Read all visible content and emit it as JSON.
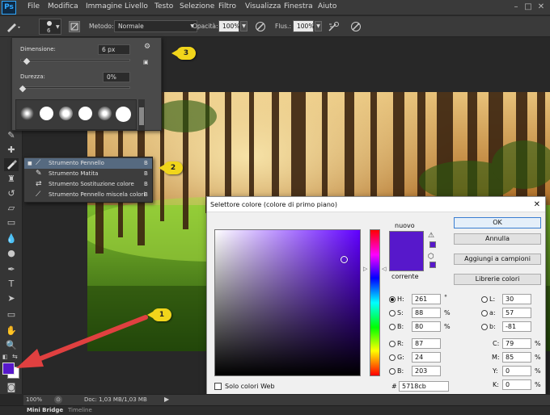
{
  "app": {
    "logo": "Ps",
    "menus": [
      "File",
      "Modifica",
      "Immagine",
      "Livello",
      "Testo",
      "Selezione",
      "Filtro",
      "Visualizza",
      "Finestra",
      "Aiuto"
    ],
    "window_controls": [
      "–",
      "□",
      "✕"
    ]
  },
  "options_bar": {
    "brush_size": "6",
    "metodo_label": "Metodo:",
    "metodo_value": "Normale",
    "opacita_label": "Opacità:",
    "opacita_value": "100%",
    "flusso_label": "Flus.:",
    "flusso_value": "100%"
  },
  "brush_popup": {
    "dimensione_label": "Dimensione:",
    "dimensione_value": "6 px",
    "durezza_label": "Durezza:",
    "durezza_value": "0%",
    "dimensione_level": 0.04,
    "durezza_level": 0.0
  },
  "tool_flyout": {
    "items": [
      {
        "label": "Strumento Pennello",
        "key": "B",
        "selected": true
      },
      {
        "label": "Strumento Matita",
        "key": "B",
        "selected": false
      },
      {
        "label": "Strumento Sostituzione colore",
        "key": "B",
        "selected": false
      },
      {
        "label": "Strumento Pennello miscela colori",
        "key": "B",
        "selected": false
      }
    ]
  },
  "callouts": [
    "1",
    "2",
    "3"
  ],
  "color_picker": {
    "title": "Selettore colore (colore di primo piano)",
    "close": "✕",
    "nuovo_label": "nuovo",
    "corrente_label": "corrente",
    "ok": "OK",
    "annulla": "Annulla",
    "aggiungi": "Aggiungi a campioni",
    "librerie": "Librerie colori",
    "solo_web": "Solo colori Web",
    "hsb": {
      "h_label": "H:",
      "h": "261",
      "h_unit": "°",
      "s_label": "S:",
      "s": "88",
      "s_unit": "%",
      "b_label": "B:",
      "b": "80",
      "b_unit": "%"
    },
    "rgb": {
      "r_label": "R:",
      "r": "87",
      "g_label": "G:",
      "g": "24",
      "b_label": "B:",
      "b": "203"
    },
    "lab": {
      "l_label": "L:",
      "l": "30",
      "a_label": "a:",
      "a": "57",
      "b_label": "b:",
      "b": "-81"
    },
    "cmyk": {
      "c_label": "C:",
      "c": "79",
      "m_label": "M:",
      "m": "85",
      "y_label": "Y:",
      "y": "0",
      "k_label": "K:",
      "k": "0",
      "unit": "%"
    },
    "hex_label": "#",
    "hex": "5718cb",
    "new_color": "#5718cb",
    "hue_color": "#6000ff"
  },
  "status_bar": {
    "zoom": "100%",
    "doc": "Doc: 1,03 MB/1,03 MB"
  },
  "bottom_tabs": [
    "Mini Bridge",
    "Timeline"
  ],
  "colors": {
    "foreground": "#5718cb",
    "background": "#ffffff",
    "arrow": "#e04040",
    "callout": "#f1d51b"
  }
}
